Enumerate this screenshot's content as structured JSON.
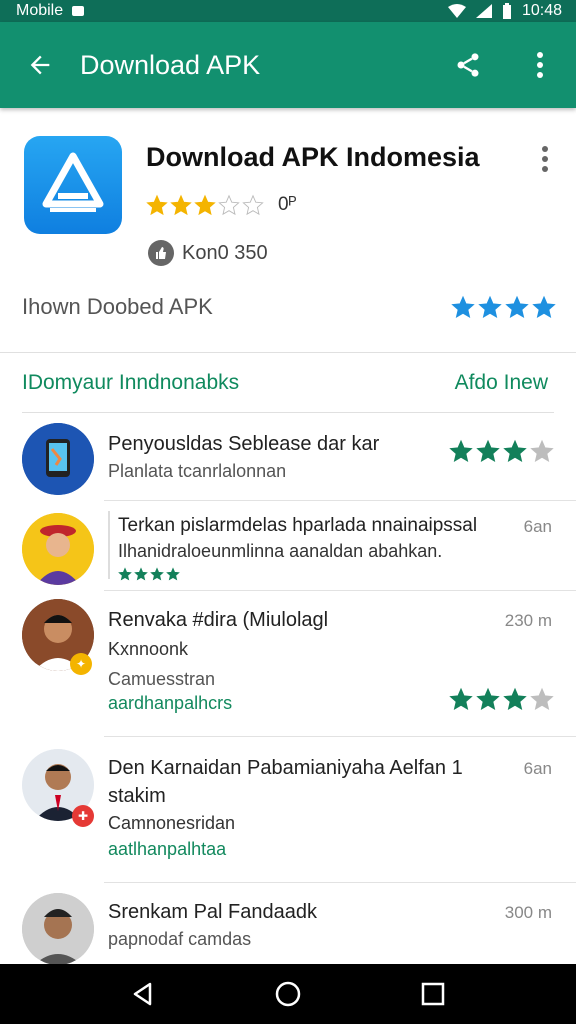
{
  "status_bar": {
    "carrier": "Mobile",
    "time": "10:48"
  },
  "app_bar": {
    "title": "Download APK",
    "back_icon": "back-arrow-icon",
    "share_icon": "share-icon",
    "more_icon": "more-vert-icon"
  },
  "app": {
    "title": "Download APK Indomesia",
    "rating_value": 3,
    "rating_count": "0ᴾ",
    "downloads_label": "Kon0 350",
    "subtitle": "Ihown Doobed APK",
    "subtitle_stars": 4,
    "icon_color": "#1890e8"
  },
  "section": {
    "title": "IDomyaur Inndnonabks",
    "link": "Afdo Inew"
  },
  "reviews": [
    {
      "name": "Penyousldas Seblease dar kar",
      "meta": "Planlata tcanrlalonnan",
      "stars": 3,
      "time": ""
    },
    {
      "name": "Terkan pislarmdelas hparlada nnainaipssal",
      "meta": "Ilhanidraloeunmlinna aanaldan abahkan.",
      "stars": 4,
      "time": "6an"
    },
    {
      "name": "Renvaka #dira (Miulolagl",
      "meta": "Kxnnoonk",
      "line3": "Camuesstran",
      "tag": "aardhanpalhcrs",
      "stars": 3,
      "time": "230 m"
    },
    {
      "name": "Den Karnaidan Pabamianiyaha Aelfan 1",
      "name2": "stakim",
      "meta": "Camnonesridan",
      "tag": "aatlhanpalhtaa",
      "stars": 0,
      "time": "6an"
    },
    {
      "name": "Srenkam Pal Fandaadk",
      "meta": "papnodaf camdas",
      "stars": 0,
      "time": "300 m"
    }
  ],
  "colors": {
    "app_bar": "#12906f",
    "status_bar": "#0e6e58",
    "accent_green": "#108a5e",
    "star_gold": "#f4b400",
    "star_blue": "#1e90e0",
    "star_green": "#13805a"
  }
}
